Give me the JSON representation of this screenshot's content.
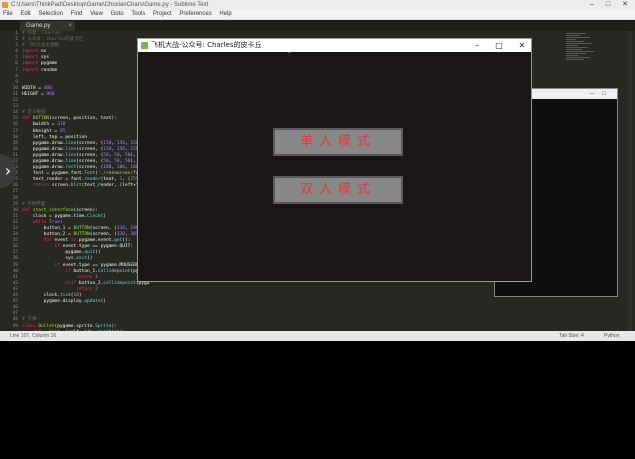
{
  "editor": {
    "title": "C:\\Users\\ThinkPad\\Desktop\\Game\\ChuxianChars\\Game.py - Sublime Text",
    "menu": [
      "File",
      "Edit",
      "Selection",
      "Find",
      "View",
      "Goto",
      "Tools",
      "Project",
      "Preferences",
      "Help"
    ],
    "tab": "Game.py",
    "line_numbers": [
      "1",
      "2",
      "3",
      "4",
      "5",
      "6",
      "7",
      "8",
      "9",
      "10",
      "11",
      "12",
      "13",
      "14",
      "15",
      "16",
      "17",
      "18",
      "19",
      "20",
      "21",
      "22",
      "23",
      "24",
      "25",
      "26",
      "27",
      "28",
      "29",
      "30",
      "31",
      "32",
      "33",
      "34",
      "35",
      "36",
      "37",
      "38",
      "39",
      "40",
      "41",
      "42",
      "43",
      "44",
      "45",
      "46",
      "47",
      "48",
      "49"
    ],
    "status_left": "Line 107, Column 16",
    "status_tab": "Tab Size: 4",
    "status_syntax": "Python"
  },
  "game_window": {
    "title": "飞机大战-公众号: Charles的皮卡丘",
    "button_single": "单人模式",
    "button_double": "双人模式"
  },
  "colors": {
    "accent_red": "#e03a3a",
    "editor_bg": "#272822"
  }
}
